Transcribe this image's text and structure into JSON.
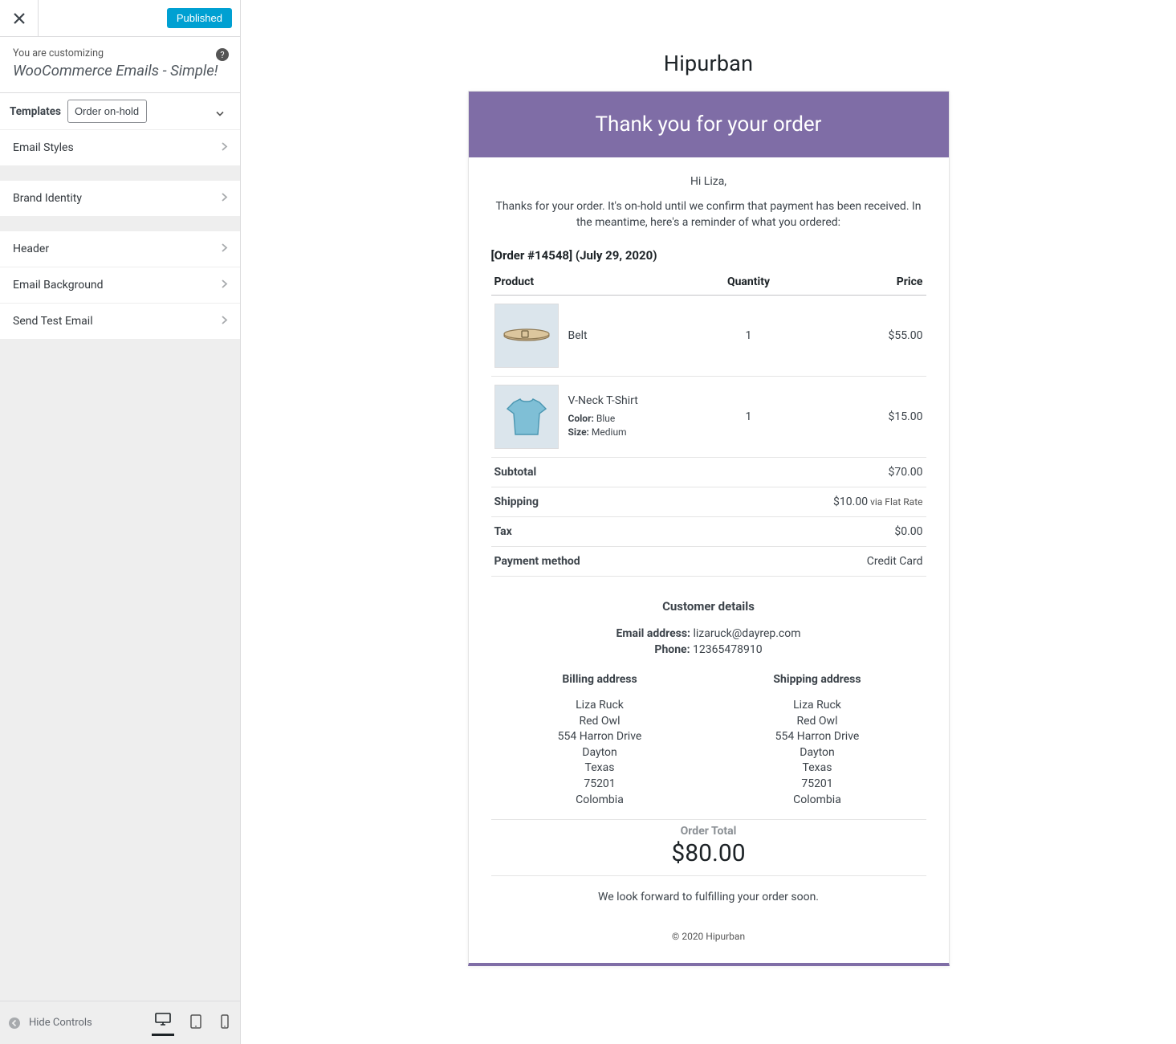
{
  "topbar": {
    "published_label": "Published"
  },
  "sidebar": {
    "you_are": "You are customizing",
    "title": "WooCommerce Emails - Simple!",
    "templates_label": "Templates",
    "templates_value": "Order on-hold",
    "rows_1": [
      "Email Styles"
    ],
    "rows_2": [
      "Brand Identity"
    ],
    "rows_3": [
      "Header",
      "Email Background",
      "Send Test Email"
    ],
    "hide_controls": "Hide Controls"
  },
  "email": {
    "brand": "Hipurban",
    "header": "Thank you for your order",
    "greeting": "Hi Liza,",
    "intro": "Thanks for your order. It's on-hold until we confirm that payment has been received. In the meantime, here's a reminder of what you ordered:",
    "order_line": "[Order #14548] (July 29, 2020)",
    "cols": {
      "product": "Product",
      "quantity": "Quantity",
      "price": "Price"
    },
    "items": [
      {
        "name": "Belt",
        "qty": "1",
        "price": "$55.00",
        "attrs": []
      },
      {
        "name": "V-Neck T-Shirt",
        "qty": "1",
        "price": "$15.00",
        "attrs": [
          {
            "label": "Color:",
            "value": " Blue"
          },
          {
            "label": "Size:",
            "value": " Medium"
          }
        ]
      }
    ],
    "totals": [
      {
        "label": "Subtotal",
        "value": "$70.00"
      },
      {
        "label": "Shipping",
        "value": "$10.00",
        "via": " via Flat Rate"
      },
      {
        "label": "Tax",
        "value": "$0.00"
      },
      {
        "label": "Payment method",
        "value": "Credit Card"
      }
    ],
    "cust_head": "Customer details",
    "cust_email_label": "Email address:",
    "cust_email": " lizaruck@dayrep.com",
    "cust_phone_label": "Phone:",
    "cust_phone": " 12365478910",
    "billing_title": "Billing address",
    "shipping_title": "Shipping address",
    "address": [
      "Liza Ruck",
      "Red Owl",
      "554 Harron Drive",
      "Dayton",
      "Texas",
      "75201",
      "Colombia"
    ],
    "order_total_label": "Order Total",
    "order_total": "$80.00",
    "look_forward": "We look forward to fulfilling your order soon.",
    "copyright": "© 2020 Hipurban"
  }
}
